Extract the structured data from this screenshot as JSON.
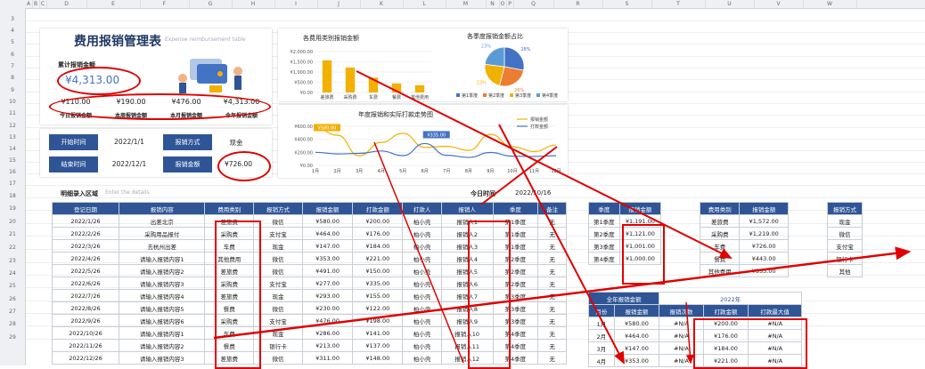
{
  "column_headers": [
    "A",
    "B",
    "C",
    "D",
    "E",
    "F",
    "G",
    "H",
    "I",
    "J",
    "K",
    "L",
    "M",
    "N",
    "O",
    "P",
    "Q",
    "R",
    "S",
    "T",
    "U",
    "V",
    "W"
  ],
  "row_numbers": [
    "3",
    "4",
    "5",
    "6",
    "7",
    "8",
    "9",
    "10",
    "11",
    "12",
    "13",
    "14",
    "15",
    "16",
    "17",
    "18",
    "19",
    "20",
    "21",
    "22",
    "23",
    "24",
    "25",
    "26",
    "27",
    "28",
    "29"
  ],
  "dashboard": {
    "title": "费用报销管理表",
    "subtitle": "Expense reimbursement table",
    "total_label": "累计报销金额",
    "total_value": "¥4,313.00",
    "kpis": [
      {
        "value": "¥110.00",
        "label": "今日报销金额"
      },
      {
        "value": "¥190.00",
        "label": "本周报销金额"
      },
      {
        "value": "¥476.00",
        "label": "本月报销金额"
      },
      {
        "value": "¥4,313.00",
        "label": "今年报销金额"
      }
    ]
  },
  "filter": {
    "start_label": "开始时间",
    "start_value": "2022/1/1",
    "end_label": "结束时间",
    "end_value": "2022/12/1",
    "method_label": "报销方式",
    "method_value": "现金",
    "amount_label": "报销金额",
    "amount_value": "¥726.00"
  },
  "chart_data": [
    {
      "type": "bar",
      "title": "各费用类别报销金额",
      "categories": [
        "差旅费",
        "采购费",
        "车费",
        "餐费",
        "其他费用"
      ],
      "values": [
        1572,
        1219,
        726,
        443,
        353
      ],
      "ylim": [
        0,
        2000
      ],
      "yticks": [
        "¥2,000.00",
        "¥1,500.00",
        "¥1,000.00",
        "¥500.00",
        "¥0.00"
      ],
      "color": "#f2b000"
    },
    {
      "type": "pie",
      "title": "各季度报销金额占比",
      "categories": [
        "第1季度",
        "第2季度",
        "第3季度",
        "第4季度"
      ],
      "values": [
        28,
        26,
        23,
        23
      ],
      "labels": [
        "28%",
        "26%",
        "23%",
        "23%"
      ],
      "colors": [
        "#4472c4",
        "#ed7d31",
        "#f2b000",
        "#5b9bd5"
      ]
    },
    {
      "type": "line",
      "title": "年度报销和实际打款走势图",
      "categories": [
        "1月",
        "2月",
        "3月",
        "4月",
        "5月",
        "6月",
        "7月",
        "8月",
        "9月",
        "10月",
        "11月",
        "12月"
      ],
      "series": [
        {
          "name": "报销金额",
          "values": [
            580,
            464,
            147,
            353,
            491,
            277,
            293,
            230,
            476,
            286,
            213,
            311
          ],
          "color": "#f2b000"
        },
        {
          "name": "打款金额",
          "values": [
            200,
            176,
            184,
            221,
            150,
            335,
            155,
            122,
            198,
            141,
            137,
            148
          ],
          "color": "#4472c4"
        }
      ],
      "callouts": [
        "¥580.00",
        "¥335.00"
      ],
      "ylim": [
        0,
        600
      ],
      "yticks": [
        "¥600.00",
        "¥400.00",
        "¥200.00",
        "¥0.00"
      ]
    }
  ],
  "entry": {
    "section_label": "明细录入区域",
    "section_hint": "Enter the details",
    "today_label": "今日时间",
    "today_value": "2022/10/16",
    "headers": [
      "登记日期",
      "报销内容",
      "费用类别",
      "报销方式",
      "报销金额",
      "打款金额",
      "打款人",
      "报销人",
      "季度",
      "备注"
    ],
    "rows": [
      [
        "2022/1/26",
        "出差北京",
        "差旅费",
        "微信",
        "¥580.00",
        "¥200.00",
        "柏小壳",
        "报销人1",
        "第1季度",
        "无"
      ],
      [
        "2022/2/26",
        "采购用品报付",
        "采购费",
        "支付宝",
        "¥464.00",
        "¥176.00",
        "柏小壳",
        "报销人2",
        "第1季度",
        "无"
      ],
      [
        "2022/3/26",
        "去杭州出差",
        "车费",
        "现金",
        "¥147.00",
        "¥184.00",
        "柏小壳",
        "报销人3",
        "第1季度",
        "无"
      ],
      [
        "2022/4/26",
        "请输入报销内容1",
        "其他费用",
        "微信",
        "¥353.00",
        "¥221.00",
        "柏小壳",
        "报销人4",
        "第2季度",
        "无"
      ],
      [
        "2022/5/26",
        "请输入报销内容2",
        "差旅费",
        "微信",
        "¥491.00",
        "¥150.00",
        "柏小壳",
        "报销人5",
        "第2季度",
        "无"
      ],
      [
        "2022/6/26",
        "请输入报销内容3",
        "采购费",
        "支付宝",
        "¥277.00",
        "¥335.00",
        "柏小壳",
        "报销人6",
        "第2季度",
        "无"
      ],
      [
        "2022/7/26",
        "请输入报销内容4",
        "差旅费",
        "现金",
        "¥293.00",
        "¥155.00",
        "柏小壳",
        "报销人7",
        "第3季度",
        "无"
      ],
      [
        "2022/8/26",
        "请输入报销内容5",
        "餐费",
        "微信",
        "¥230.00",
        "¥122.00",
        "柏小壳",
        "报销人8",
        "第3季度",
        "无"
      ],
      [
        "2022/9/26",
        "请输入报销内容6",
        "采购费",
        "支付宝",
        "¥476.00",
        "¥198.00",
        "柏小壳",
        "报销人9",
        "第3季度",
        "无"
      ],
      [
        "2022/10/26",
        "请输入报销内容1",
        "车费",
        "现金",
        "¥286.00",
        "¥141.00",
        "柏小壳",
        "报销人10",
        "第4季度",
        "无"
      ],
      [
        "2022/11/26",
        "请输入报销内容2",
        "餐费",
        "银行卡",
        "¥213.00",
        "¥137.00",
        "柏小壳",
        "报销人11",
        "第4季度",
        "无"
      ],
      [
        "2022/12/26",
        "请输入报销内容3",
        "差旅费",
        "微信",
        "¥311.00",
        "¥148.00",
        "柏小壳",
        "报销人12",
        "第4季度",
        "无"
      ]
    ]
  },
  "quarter_table": {
    "title": "季度报销金额",
    "headers": [
      "季度",
      "报销金额"
    ],
    "rows": [
      [
        "第1季度",
        "¥1,191.00"
      ],
      [
        "第2季度",
        "¥1,121.00"
      ],
      [
        "第3季度",
        "¥1,001.00"
      ],
      [
        "第4季度",
        "¥1,000.00"
      ]
    ]
  },
  "category_table": {
    "headers": [
      "费用类别",
      "报销金额"
    ],
    "rows": [
      [
        "差旅费",
        "¥1,572.00"
      ],
      [
        "采购费",
        "¥1,219.00"
      ],
      [
        "车费",
        "¥726.00"
      ],
      [
        "餐费",
        "¥443.00"
      ],
      [
        "其他费用",
        "¥353.00"
      ]
    ]
  },
  "method_table": {
    "headers": [
      "报销方式"
    ],
    "rows": [
      [
        "现金"
      ],
      [
        "微信"
      ],
      [
        "支付宝"
      ],
      [
        "银行卡"
      ],
      [
        "其他"
      ]
    ]
  },
  "year_table": {
    "title": "全年报销金额",
    "year": "2022年",
    "headers": [
      "月份",
      "报销金额",
      "报销次数",
      "打款金额",
      "打款最大值"
    ],
    "rows": [
      [
        "1月",
        "¥580.00",
        "#N/A",
        "¥200.00",
        "#N/A"
      ],
      [
        "2月",
        "¥464.00",
        "#N/A",
        "¥176.00",
        "#N/A"
      ],
      [
        "3月",
        "¥147.00",
        "#N/A",
        "¥184.00",
        "#N/A"
      ],
      [
        "4月",
        "¥353.00",
        "#N/A",
        "¥221.00",
        "#N/A"
      ]
    ]
  }
}
